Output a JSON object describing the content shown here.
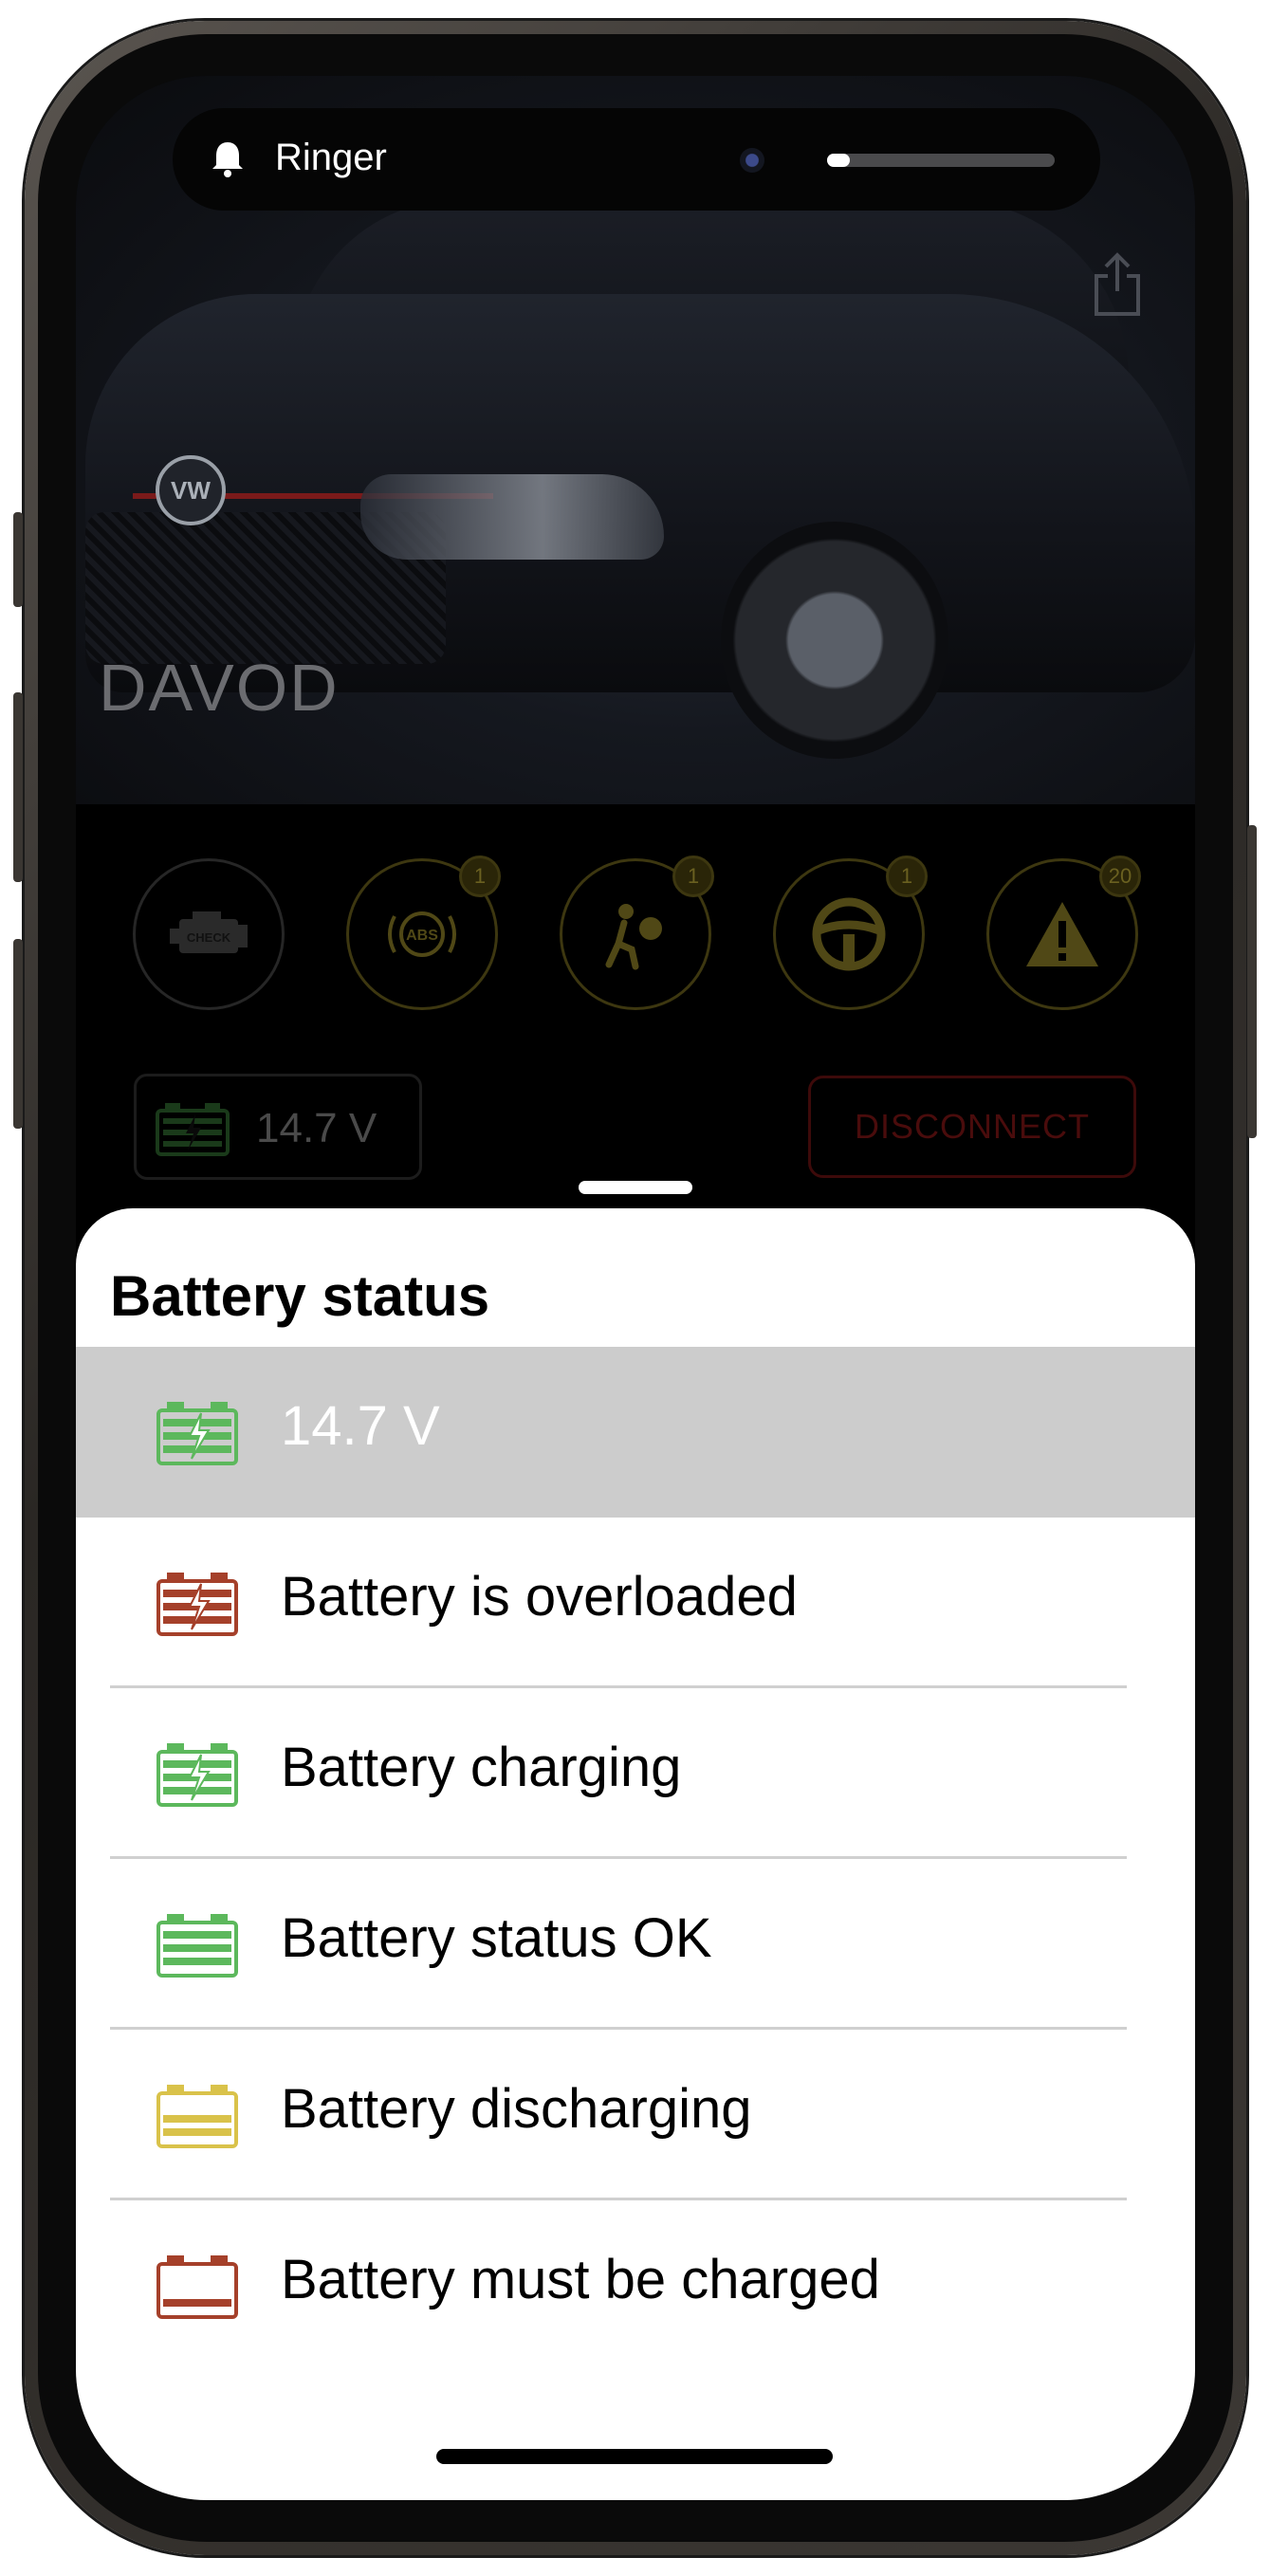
{
  "status_bar": {
    "ringer_label": "Ringer",
    "ringer_volume_fraction": 0.1
  },
  "hero": {
    "vehicle_name": "DAVOD"
  },
  "warning_lights": [
    {
      "name": "check-engine",
      "text": "CHECK",
      "count": ""
    },
    {
      "name": "abs",
      "text": "ABS",
      "count": "1"
    },
    {
      "name": "airbag",
      "text": "",
      "count": "1"
    },
    {
      "name": "steering",
      "text": "",
      "count": "1"
    },
    {
      "name": "general-warning",
      "text": "",
      "count": "20"
    }
  ],
  "voltage_chip": {
    "value": "14.7 V"
  },
  "disconnect_label": "DISCONNECT",
  "sheet": {
    "title": "Battery status",
    "rows": [
      {
        "label": "14.7 V",
        "icon": "battery-charging-icon",
        "color": "#5cb85c",
        "selected": true
      },
      {
        "label": "Battery is overloaded",
        "icon": "battery-overloaded-icon",
        "color": "#a5402a",
        "selected": false
      },
      {
        "label": "Battery charging",
        "icon": "battery-charging-icon",
        "color": "#5cb85c",
        "selected": false
      },
      {
        "label": "Battery status OK",
        "icon": "battery-ok-icon",
        "color": "#5cb85c",
        "selected": false
      },
      {
        "label": "Battery discharging",
        "icon": "battery-discharging-icon",
        "color": "#d9c24a",
        "selected": false
      },
      {
        "label": "Battery must be charged",
        "icon": "battery-empty-icon",
        "color": "#a5402a",
        "selected": false
      }
    ]
  },
  "colors": {
    "accent_green": "#5cb85c",
    "accent_red": "#a5402a",
    "accent_yellow": "#d9c24a",
    "selected_row_bg": "#cccccc"
  }
}
